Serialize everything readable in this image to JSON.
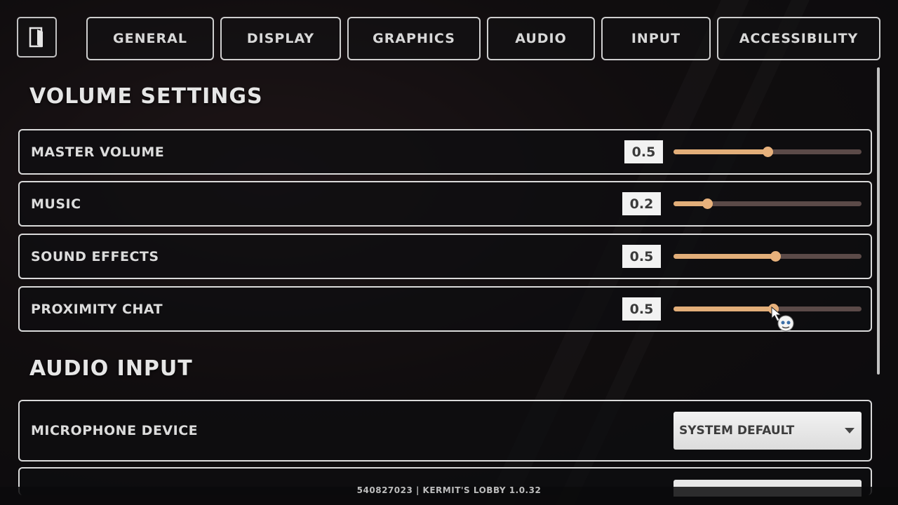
{
  "tabs": [
    "GENERAL",
    "DISPLAY",
    "GRAPHICS",
    "AUDIO",
    "INPUT",
    "ACCESSIBILITY"
  ],
  "volume_section": {
    "title": "VOLUME SETTINGS",
    "sliders": [
      {
        "label": "MASTER VOLUME",
        "value_text": "0.5",
        "level": 0.5
      },
      {
        "label": "MUSIC",
        "value_text": "0.2",
        "level": 0.18
      },
      {
        "label": "SOUND EFFECTS",
        "value_text": "0.5",
        "level": 0.54
      },
      {
        "label": "PROXIMITY CHAT",
        "value_text": "0.5",
        "level": 0.53
      }
    ]
  },
  "audio_input_section": {
    "title": "AUDIO INPUT",
    "microphone_label": "MICROPHONE DEVICE",
    "microphone_value": "SYSTEM DEFAULT"
  },
  "footer": {
    "text": "540827023 | KERMIT'S LOBBY  1.0.32"
  },
  "colors": {
    "accent": "#e2ae79",
    "track": "#5b4a48",
    "border": "#ffffff"
  },
  "icons": {
    "exit": "door-exit-icon",
    "dropdown": "triangle-down-icon"
  }
}
